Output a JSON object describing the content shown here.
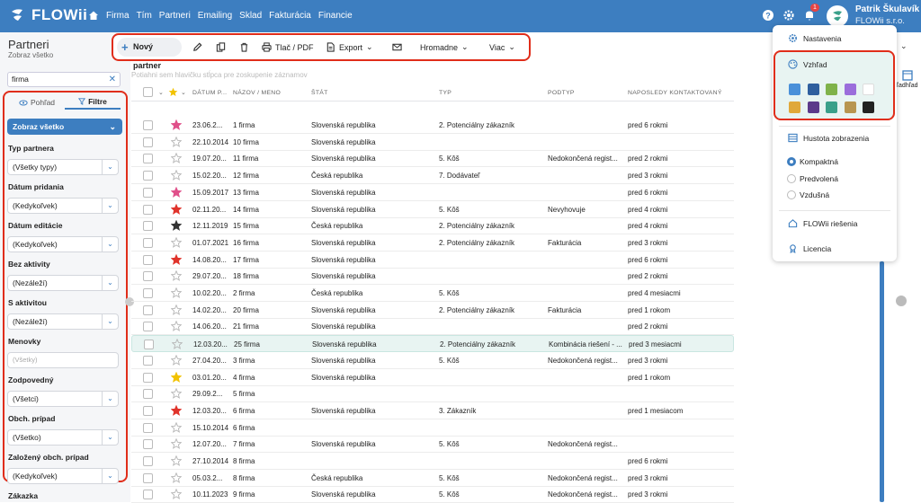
{
  "app": {
    "logo": "FLOWii"
  },
  "nav": [
    "Firma",
    "Tím",
    "Partneri",
    "Emailing",
    "Sklad",
    "Fakturácia",
    "Financie"
  ],
  "user": {
    "name": "Patrik Škulavík",
    "company": "FLOWii s.r.o.",
    "notifications": "1"
  },
  "page": {
    "title": "Partneri",
    "subtitle": "Zobraz všetko"
  },
  "search": {
    "value": "firma"
  },
  "toolbar": {
    "new_partner": "Nový partner",
    "print": "Tlač / PDF",
    "export": "Export",
    "bulk": "Hromadne",
    "more": "Viac"
  },
  "hint": "Potiahni sem hlavičku stĺpca pre zoskupenie záznamov",
  "filters": {
    "tab_view": "Pohľad",
    "tab_filters": "Filtre",
    "show_all": "Zobraz všetko",
    "groups": [
      {
        "label": "Typ partnera",
        "value": "(Všetky typy)"
      },
      {
        "label": "Dátum pridania",
        "value": "(Kedykoľvek)"
      },
      {
        "label": "Dátum editácie",
        "value": "(Kedykoľvek)"
      },
      {
        "label": "Bez aktivity",
        "value": "(Nezáleží)"
      },
      {
        "label": "S aktivitou",
        "value": "(Nezáleží)"
      },
      {
        "label": "Menovky",
        "value": "(Všetky)"
      },
      {
        "label": "Zodpovedný",
        "value": "(Všetci)"
      },
      {
        "label": "Obch. prípad",
        "value": "(Všetko)"
      },
      {
        "label": "Založený obch. prípad",
        "value": "(Kedykoľvek)"
      },
      {
        "label": "Zákazka",
        "value": ""
      }
    ]
  },
  "table": {
    "headers": [
      "DÁTUM P...",
      "NÁZOV / MENO",
      "ŠTÁT",
      "TYP",
      "PODTYP",
      "NAPOSLEDY KONTAKTOVANÝ"
    ],
    "rows": [
      {
        "star": "pink",
        "date": "23.06.2...",
        "name": "1 firma",
        "state": "Slovenská republika",
        "type": "2. Potenciálny zákazník",
        "subtype": "",
        "last": "pred 6 rokmi"
      },
      {
        "star": "none",
        "date": "22.10.2014",
        "name": "10 firma",
        "state": "Slovenská republika",
        "type": "",
        "subtype": "",
        "last": ""
      },
      {
        "star": "none",
        "date": "19.07.20...",
        "name": "11 firma",
        "state": "Slovenská republika",
        "type": "5. Kôš",
        "subtype": "Nedokončená regist...",
        "last": "pred 2 rokmi"
      },
      {
        "star": "none",
        "date": "15.02.20...",
        "name": "12 firma",
        "state": "Česká republika",
        "type": "7. Dodávateľ",
        "subtype": "",
        "last": "pred 3 rokmi"
      },
      {
        "star": "pink",
        "date": "15.09.2017",
        "name": "13 firma",
        "state": "Slovenská republika",
        "type": "",
        "subtype": "",
        "last": "pred 6 rokmi"
      },
      {
        "star": "red",
        "date": "02.11.20...",
        "name": "14 firma",
        "state": "Slovenská republika",
        "type": "5. Kôš",
        "subtype": "Nevyhovuje",
        "last": "pred 4 rokmi"
      },
      {
        "star": "dark",
        "date": "12.11.2019",
        "name": "15 firma",
        "state": "Česká republika",
        "type": "2. Potenciálny zákazník",
        "subtype": "",
        "last": "pred 4 rokmi"
      },
      {
        "star": "none",
        "date": "01.07.2021",
        "name": "16 firma",
        "state": "Slovenská republika",
        "type": "2. Potenciálny zákazník",
        "subtype": "Fakturácia",
        "last": "pred 3 rokmi"
      },
      {
        "star": "red",
        "date": "14.08.20...",
        "name": "17 firma",
        "state": "Slovenská republika",
        "type": "",
        "subtype": "",
        "last": "pred 6 rokmi"
      },
      {
        "star": "none",
        "date": "29.07.20...",
        "name": "18 firma",
        "state": "Slovenská republika",
        "type": "",
        "subtype": "",
        "last": "pred 2 rokmi"
      },
      {
        "star": "none",
        "date": "10.02.20...",
        "name": "2 firma",
        "state": "Česká republika",
        "type": "5. Kôš",
        "subtype": "",
        "last": "pred 4 mesiacmi"
      },
      {
        "star": "none",
        "date": "14.02.20...",
        "name": "20 firma",
        "state": "Slovenská republika",
        "type": "2. Potenciálny zákazník",
        "subtype": "Fakturácia",
        "last": "pred 1 rokom"
      },
      {
        "star": "none",
        "date": "14.06.20...",
        "name": "21 firma",
        "state": "Slovenská republika",
        "type": "",
        "subtype": "",
        "last": "pred 2 rokmi"
      },
      {
        "star": "none",
        "date": "12.03.20...",
        "name": "25 firma",
        "state": "Slovenská republika",
        "type": "2. Potenciálny zákazník",
        "subtype": "Kombinácia riešení - ...",
        "last": "pred 3 mesiacmi",
        "highlight": true
      },
      {
        "star": "none",
        "date": "27.04.20...",
        "name": "3 firma",
        "state": "Slovenská republika",
        "type": "5. Kôš",
        "subtype": "Nedokončená regist...",
        "last": "pred 3 rokmi"
      },
      {
        "star": "yellow",
        "date": "03.01.20...",
        "name": "4 firma",
        "state": "Slovenská republika",
        "type": "",
        "subtype": "",
        "last": "pred 1 rokom"
      },
      {
        "star": "none",
        "date": "29.09.2...",
        "name": "5 firma",
        "state": "",
        "type": "",
        "subtype": "",
        "last": ""
      },
      {
        "star": "red",
        "date": "12.03.20...",
        "name": "6 firma",
        "state": "Slovenská republika",
        "type": "3. Zákazník",
        "subtype": "",
        "last": "pred 1 mesiacom"
      },
      {
        "star": "none",
        "date": "15.10.2014",
        "name": "6 firma",
        "state": "",
        "type": "",
        "subtype": "",
        "last": ""
      },
      {
        "star": "none",
        "date": "12.07.20...",
        "name": "7 firma",
        "state": "Slovenská republika",
        "type": "5. Kôš",
        "subtype": "Nedokončená regist...",
        "last": ""
      },
      {
        "star": "none",
        "date": "27.10.2014",
        "name": "8 firma",
        "state": "",
        "type": "",
        "subtype": "",
        "last": "pred 6 rokmi"
      },
      {
        "star": "none",
        "date": "05.03.2...",
        "name": "8 firma",
        "state": "Česká republika",
        "type": "5. Kôš",
        "subtype": "Nedokončená regist...",
        "last": "pred 3 rokmi"
      },
      {
        "star": "none",
        "date": "10.11.2023",
        "name": "9 firma",
        "state": "Slovenská republika",
        "type": "5. Kôš",
        "subtype": "Nedokončená regist...",
        "last": "pred 3 rokmi"
      }
    ]
  },
  "menu": {
    "settings": "Nastavenia",
    "appearance": "Vzhľad",
    "density": "Hustota zobrazenia",
    "compact": "Kompaktná",
    "default": "Predvolená",
    "airy": "Vzdušná",
    "solutions": "FLOWii riešenia",
    "license": "Licencia",
    "swatches": [
      "#4a90d9",
      "#2f5f9e",
      "#7fb24a",
      "#9b6ddb",
      "#ffffff",
      "#e0a83a",
      "#5b3a8a",
      "#3aa08a",
      "#b89550",
      "#222222"
    ]
  },
  "right_panel": {
    "label": "ľadhľad"
  },
  "colors": {
    "brand": "#3d7ec0",
    "highlight": "#e8f4f2",
    "annotation": "#e02d1a"
  }
}
